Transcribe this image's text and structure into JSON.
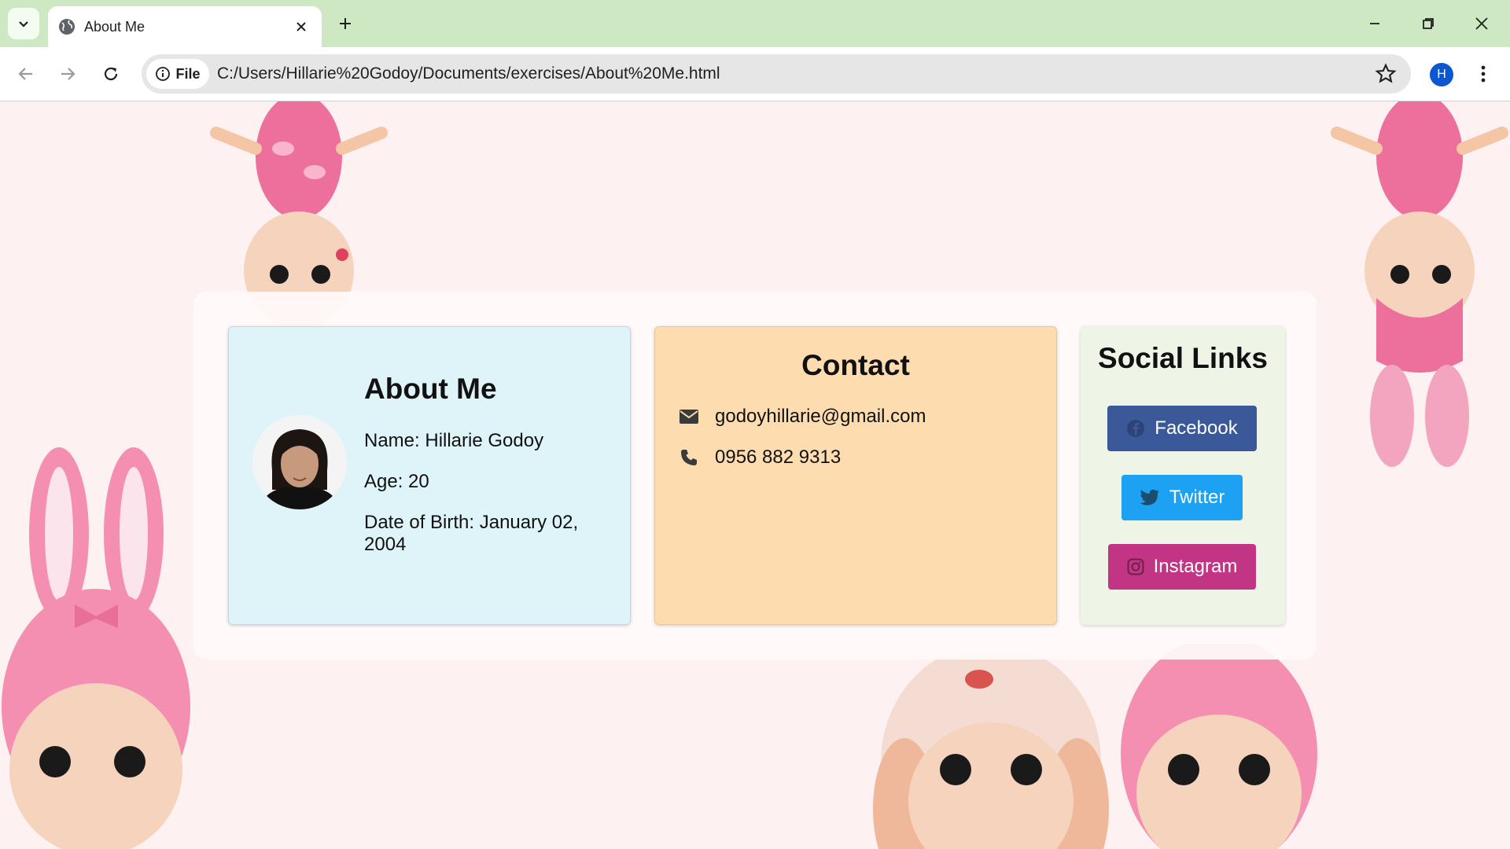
{
  "browser": {
    "tab_title": "About Me",
    "file_chip": "File",
    "url": "C:/Users/Hillarie%20Godoy/Documents/exercises/About%20Me.html",
    "profile_initial": "H"
  },
  "about": {
    "title": "About Me",
    "name": "Name: Hillarie Godoy",
    "age": "Age: 20",
    "dob": "Date of Birth: January 02, 2004"
  },
  "contact": {
    "title": "Contact",
    "email": "godoyhillarie@gmail.com",
    "phone": "0956 882 9313"
  },
  "social": {
    "title": "Social Links",
    "facebook": "Facebook",
    "twitter": "Twitter",
    "instagram": "Instagram"
  },
  "colors": {
    "tabbar": "#cfe8c4",
    "about_card": "#dff4f8",
    "contact_card": "#fdddb0",
    "social_card": "#eef4e6",
    "facebook": "#3b5998",
    "twitter": "#1da1f2",
    "instagram": "#c13584"
  }
}
